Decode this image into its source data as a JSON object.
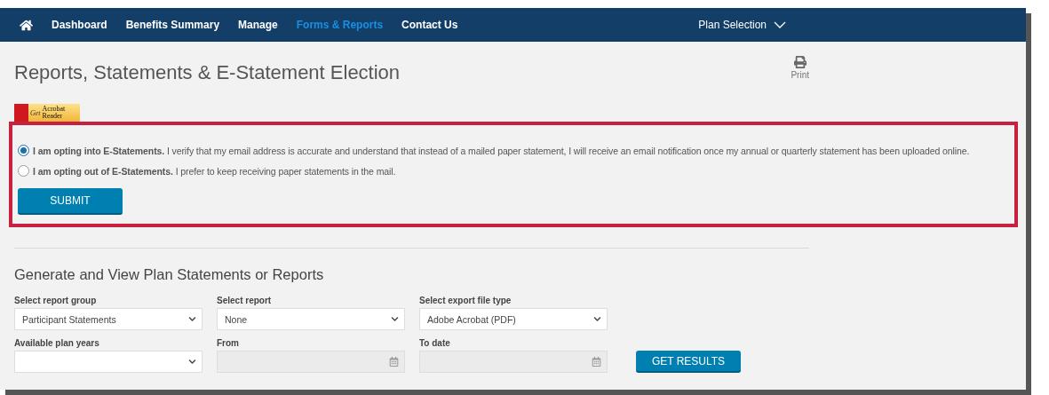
{
  "nav": {
    "items": [
      {
        "label": "Dashboard",
        "selected": false
      },
      {
        "label": "Benefits Summary",
        "selected": false
      },
      {
        "label": "Manage",
        "selected": false
      },
      {
        "label": "Forms & Reports",
        "selected": true
      },
      {
        "label": "Contact Us",
        "selected": false
      }
    ],
    "plan_selection": "Plan Selection"
  },
  "title": "Reports, Statements & E-Statement Election",
  "print": "Print",
  "acrobat_badge": {
    "small": "Get",
    "line1": "Acrobat",
    "line2": "Reader"
  },
  "election": {
    "options": [
      {
        "text": "**I am opting into E-Statements.** I verify that my email address is accurate and understand that instead of a mailed paper statement, I will receive an email notification once my annual or quarterly statement has been uploaded online.",
        "selected": true
      },
      {
        "text": "**I am opting out of E-Statements.** I prefer to keep receiving paper statements in the mail.",
        "selected": false
      }
    ],
    "submit": "SUBMIT"
  },
  "reports": {
    "heading": "Generate and View Plan Statements or Reports",
    "fields": [
      {
        "kind": "select",
        "label": "Select report group",
        "value": "Participant Statements"
      },
      {
        "kind": "select",
        "label": "Select report",
        "value": "None"
      },
      {
        "kind": "select",
        "label": "Select export file type",
        "value": "Adobe Acrobat (PDF)"
      },
      {
        "kind": "select",
        "label": "Available plan years"
      },
      {
        "kind": "date",
        "label": "From"
      },
      {
        "kind": "date",
        "label": "To date"
      }
    ],
    "get_results": "GET RESULTS"
  }
}
